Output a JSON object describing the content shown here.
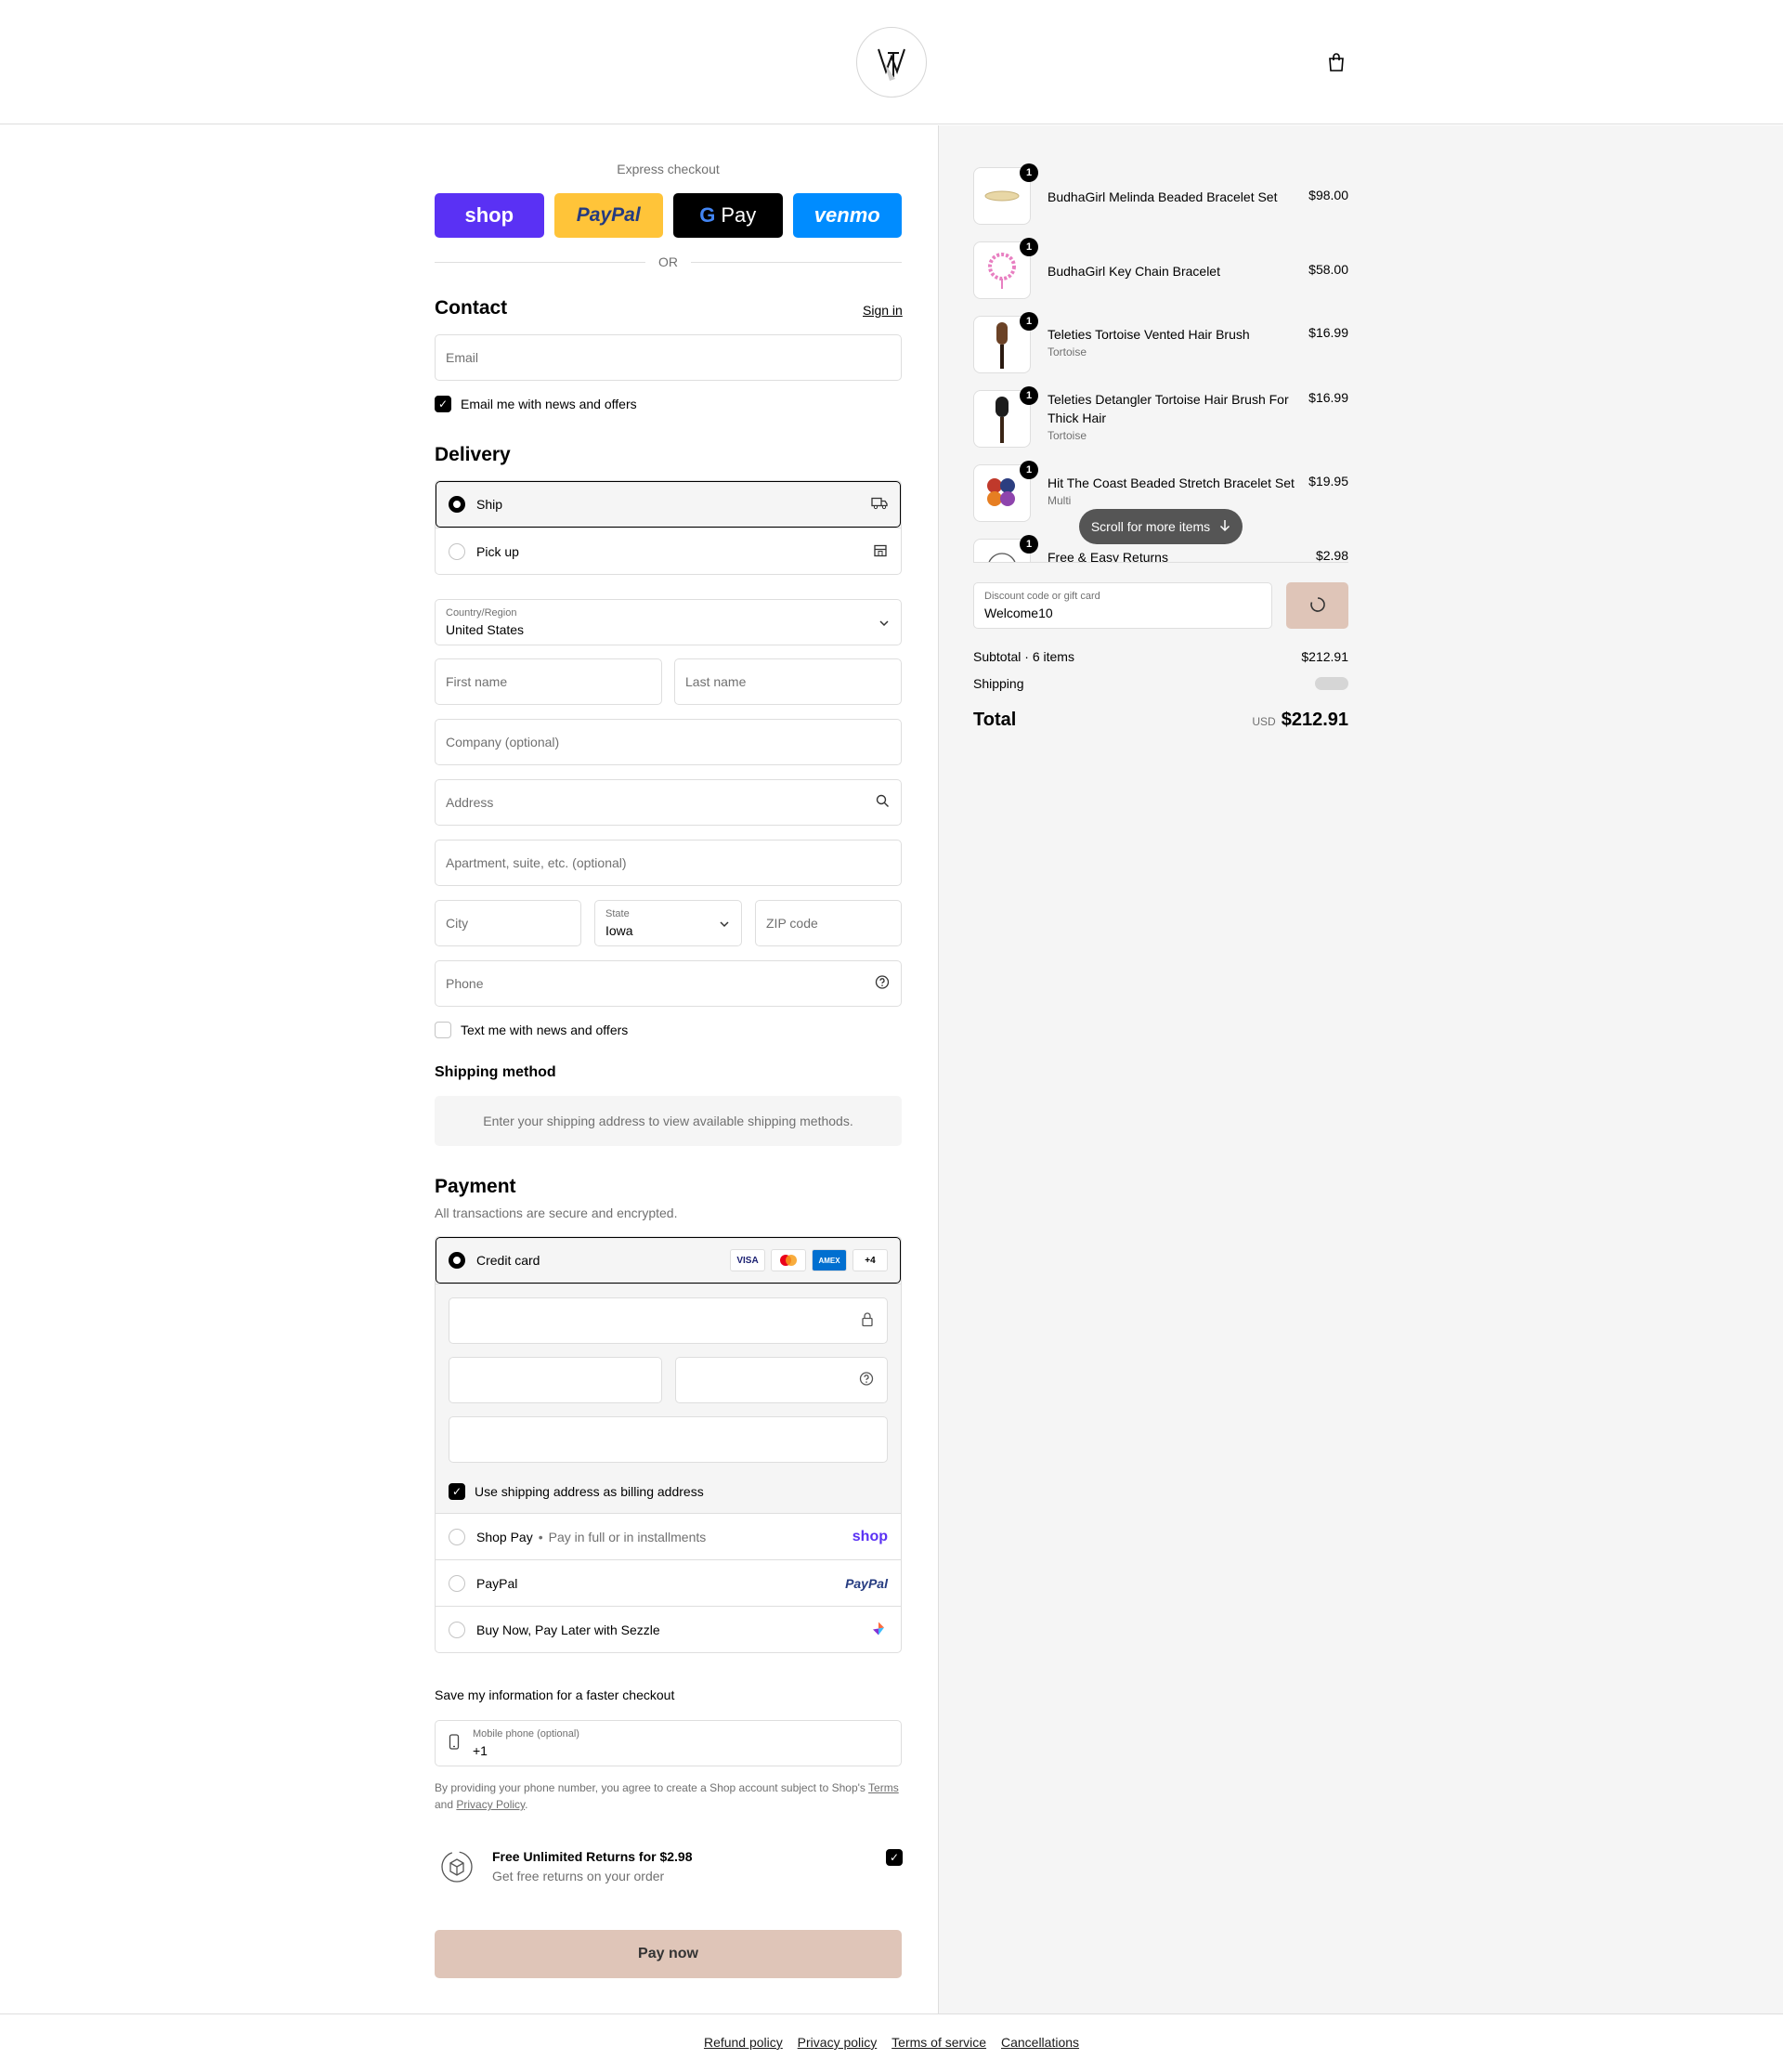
{
  "header": {
    "logo_text": "WT",
    "cart_icon": "shopping-bag-icon"
  },
  "express": {
    "title": "Express checkout",
    "buttons": [
      "shop",
      "PayPal",
      "Pay",
      "venmo"
    ],
    "or_label": "OR"
  },
  "contact": {
    "title": "Contact",
    "sign_in": "Sign in",
    "email_placeholder": "Email",
    "email_news_label": "Email me with news and offers"
  },
  "delivery": {
    "title": "Delivery",
    "options": [
      "Ship",
      "Pick up"
    ],
    "country_label": "Country/Region",
    "country_value": "United States",
    "first_name": "First name",
    "last_name": "Last name",
    "company": "Company (optional)",
    "address": "Address",
    "apartment": "Apartment, suite, etc. (optional)",
    "city": "City",
    "state_label": "State",
    "state_value": "Iowa",
    "zip": "ZIP code",
    "phone": "Phone",
    "text_news_label": "Text me with news and offers"
  },
  "shipping_method": {
    "title": "Shipping method",
    "note": "Enter your shipping address to view available shipping methods."
  },
  "payment": {
    "title": "Payment",
    "subtitle": "All transactions are secure and encrypted.",
    "credit_card": "Credit card",
    "card_badges": [
      "VISA",
      "MC",
      "AMEX",
      "+4"
    ],
    "billing_same": "Use shipping address as billing address",
    "shop_pay": "Shop Pay",
    "shop_pay_sub": "Pay in full or in installments",
    "shop_pay_logo": "shop",
    "paypal": "PayPal",
    "paypal_logo": "PayPal",
    "sezzle": "Buy Now, Pay Later with Sezzle"
  },
  "save_info": {
    "title": "Save my information for a faster checkout",
    "phone_label": "Mobile phone (optional)",
    "phone_value": "+1",
    "disclaimer_1": "By providing your phone number, you agree to create a Shop account subject to Shop's",
    "terms": "Terms",
    "and": "and",
    "privacy": "Privacy Policy",
    "period": "."
  },
  "returns": {
    "title": "Free Unlimited Returns for $2.98",
    "subtitle": "Get free returns on your order"
  },
  "pay_now": "Pay now",
  "footer_links": [
    "Refund policy",
    "Privacy policy",
    "Terms of service",
    "Cancellations"
  ],
  "summary": {
    "items": [
      {
        "name": "BudhaGirl Melinda Beaded Bracelet Set",
        "variant": "",
        "price": "$98.00",
        "qty": "1"
      },
      {
        "name": "BudhaGirl Key Chain Bracelet",
        "variant": "",
        "price": "$58.00",
        "qty": "1"
      },
      {
        "name": "Teleties Tortoise Vented Hair Brush",
        "variant": "Tortoise",
        "price": "$16.99",
        "qty": "1"
      },
      {
        "name": "Teleties Detangler Tortoise Hair Brush For Thick Hair",
        "variant": "Tortoise",
        "price": "$16.99",
        "qty": "1"
      },
      {
        "name": "Hit The Coast Beaded Stretch Bracelet Set",
        "variant": "Multi",
        "price": "$19.95",
        "qty": "1"
      },
      {
        "name": "Free & Easy Returns",
        "variant": "",
        "price": "$2.98",
        "qty": "1"
      }
    ],
    "scroll_label": "Scroll for more items",
    "discount_label": "Discount code or gift card",
    "discount_value": "Welcome10",
    "subtotal_label": "Subtotal · 6 items",
    "subtotal_value": "$212.91",
    "shipping_label": "Shipping",
    "total_label": "Total",
    "currency": "USD",
    "total_value": "$212.91"
  }
}
